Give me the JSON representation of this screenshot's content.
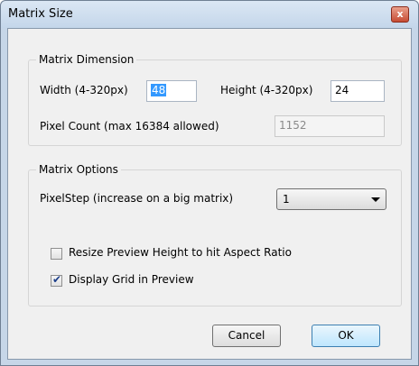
{
  "window": {
    "title": "Matrix Size",
    "close_glyph": "x"
  },
  "matrix_dimension": {
    "legend": "Matrix Dimension",
    "width_label": "Width (4-320px)",
    "width_value": "48",
    "height_label": "Height (4-320px)",
    "height_value": "24",
    "pixel_count_label": "Pixel Count (max 16384 allowed)",
    "pixel_count_value": "1152"
  },
  "matrix_options": {
    "legend": "Matrix Options",
    "pixelstep_label": "PixelStep (increase on a big matrix)",
    "pixelstep_value": "1",
    "resize_label": "Resize Preview Height to hit Aspect Ratio",
    "resize_checked": false,
    "grid_label": "Display Grid in Preview",
    "grid_checked": true
  },
  "buttons": {
    "cancel": "Cancel",
    "ok": "OK"
  },
  "colors": {
    "selection": "#3399ff",
    "window_frame": "#c6d6e8",
    "close_button": "#c74c34"
  },
  "icons": {
    "close": "close-icon",
    "dropdown": "chevron-down-icon",
    "check": "checkmark-icon"
  }
}
